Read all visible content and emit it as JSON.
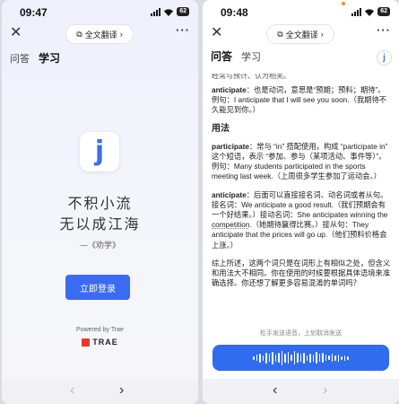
{
  "left": {
    "status": {
      "time": "09:47",
      "battery": "62"
    },
    "nav": {
      "translate": "全文翻译",
      "close": "✕",
      "more": "···",
      "chevron": "›"
    },
    "tabs": [
      {
        "label": "问答"
      },
      {
        "label": "学习"
      }
    ],
    "logo_letter": "j",
    "poem": {
      "line1": "不积小流",
      "line2": "无以成江海",
      "source": "—《劝学》"
    },
    "login_label": "立即登录",
    "powered_by": "Powered by Trae",
    "brand": "TRAE",
    "bottom": {
      "back": "‹",
      "forward": "›"
    }
  },
  "right": {
    "status": {
      "time": "09:48",
      "battery": "62"
    },
    "nav": {
      "translate": "全文翻译",
      "close": "✕",
      "more": "···",
      "chevron": "›"
    },
    "tabs": [
      {
        "label": "问答"
      },
      {
        "label": "学习"
      }
    ],
    "badge_letter": "j",
    "content": {
      "cut_line": "经常与预计、认为相关。",
      "anticipate1_word": "anticipate",
      "anticipate1_text": "：也是动词，意思是“预期；预料；期待”。例句：I anticipate that I will see you soon.（我期待不久能见到你。）",
      "usage_heading": "用法",
      "participate_word": "participate",
      "participate_text": "：常与 “in” 搭配使用，构成 “participate in” 这个短语，表示 “参加、参与（某项活动、事件等）”。例句：Many students participated in the sports meeting last week.（上周很多学生参加了运动会。）",
      "anticipate2_word": "anticipate",
      "anticipate2_text_a": "：后面可以直接接名词、动名词或者从句。接名词：We anticipate a good result.（我们预期会有一个好结果。）接动名词：She anticipates winning the ",
      "anticipate2_underlined": "competition",
      "anticipate2_text_b": ".（她期待赢得比赛。）接从句：They anticipate that the prices will go up.（他们预料价格会上涨。）",
      "summary": "综上所述，这两个词只是在词形上有相似之处，但含义和用法大不相同。你在使用的时候要根据具体语境来准确选择。你还想了解更多容易混淆的单词吗？"
    },
    "voice_hint": "松手发送语音，上划取消发送",
    "bottom": {
      "back": "‹",
      "forward": "›"
    }
  },
  "colors": {
    "accent": "#3a6bf2",
    "brand_red": "#e5392f",
    "voice_blue": "#2f6cf0"
  }
}
